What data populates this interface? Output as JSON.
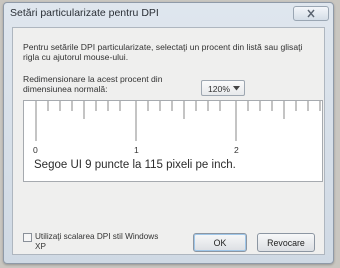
{
  "window": {
    "title": "Setări particularizate pentru DPI",
    "close_icon": "close-icon"
  },
  "content": {
    "intro": "Pentru setările DPI particularizate, selectaţi un procent din listă sau glisaţi rigla cu ajutorul mouse-ului.",
    "scale_label": "Redimensionare la acest procent din dimensiunea normală:",
    "scale_value": "120%",
    "ruler_labels": [
      "0",
      "1",
      "2"
    ],
    "sample_text": "Segoe UI 9 puncte la 115 pixeli pe inch."
  },
  "footer": {
    "checkbox_label": "Utilizaţi scalarea DPI stil Windows XP",
    "checkbox_checked": false,
    "ok_label": "OK",
    "cancel_label": "Revocare"
  }
}
